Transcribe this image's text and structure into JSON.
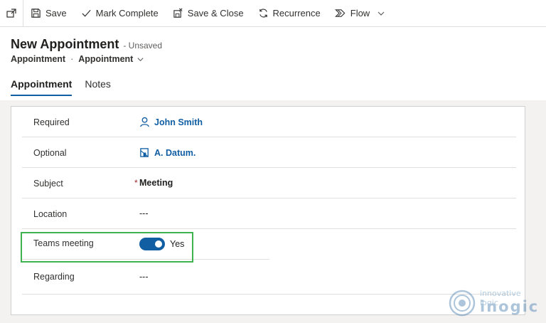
{
  "toolbar": {
    "popout_icon": "popout-icon",
    "save": "Save",
    "mark_complete": "Mark Complete",
    "save_close": "Save & Close",
    "recurrence": "Recurrence",
    "flow": "Flow"
  },
  "header": {
    "title": "New Appointment",
    "status": "- Unsaved",
    "breadcrumb_entity": "Appointment",
    "breadcrumb_separator": "·",
    "breadcrumb_form": "Appointment"
  },
  "tabs": [
    {
      "label": "Appointment",
      "active": true
    },
    {
      "label": "Notes",
      "active": false
    }
  ],
  "fields": {
    "required": {
      "label": "Required",
      "value": "John Smith",
      "icon": "person-icon"
    },
    "optional": {
      "label": "Optional",
      "value": "A. Datum.",
      "icon": "account-icon"
    },
    "subject": {
      "label": "Subject",
      "required_marker": "*",
      "value": "Meeting"
    },
    "location": {
      "label": "Location",
      "value": "---"
    },
    "teams": {
      "label": "Teams meeting",
      "value": "Yes",
      "toggle_on": true
    },
    "regarding": {
      "label": "Regarding",
      "value": "---"
    }
  },
  "watermark": {
    "tagline": "innovative logic",
    "brand": "inogic"
  },
  "colors": {
    "accent": "#115ea3",
    "highlight": "#3fb34f",
    "required": "#a4262c"
  }
}
